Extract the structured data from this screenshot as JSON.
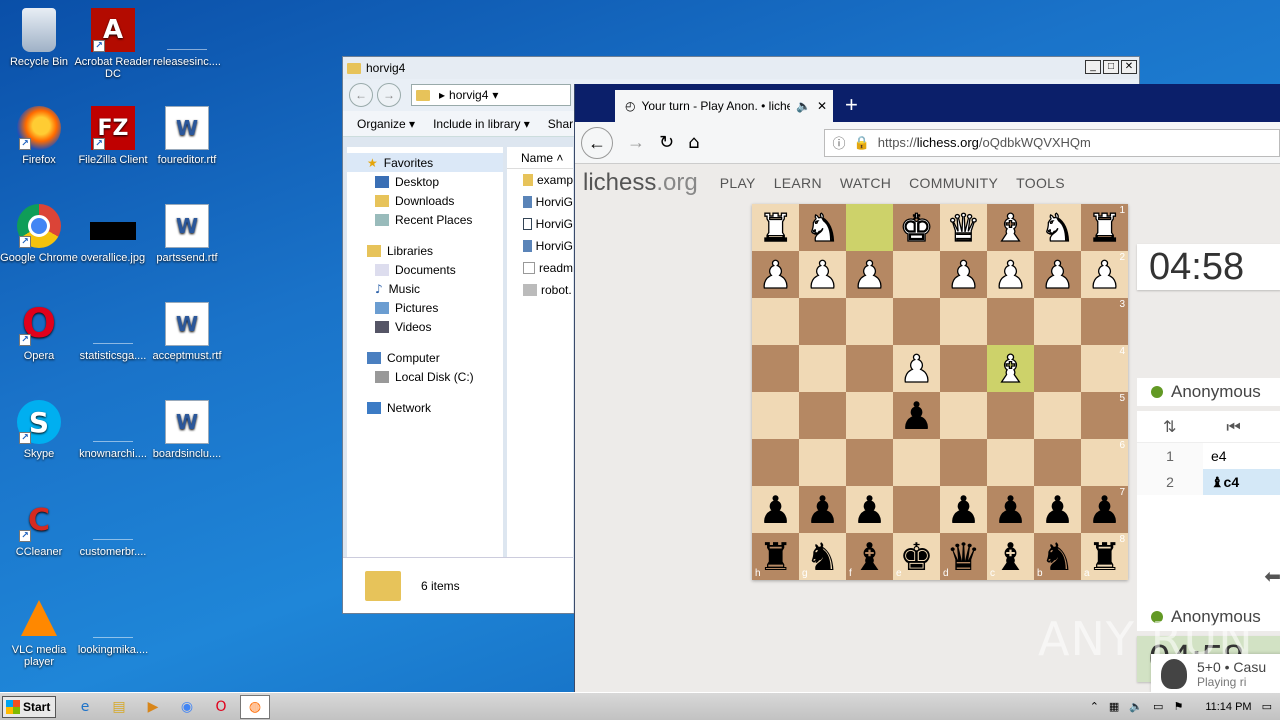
{
  "desktop": {
    "icons": [
      {
        "label": "Recycle Bin",
        "glyph": ""
      },
      {
        "label": "Acrobat Reader DC",
        "glyph": "A"
      },
      {
        "label": "releasesinc....",
        "glyph": ""
      },
      {
        "label": "Firefox",
        "glyph": ""
      },
      {
        "label": "FileZilla Client",
        "glyph": "FZ"
      },
      {
        "label": "foureditor.rtf",
        "glyph": "W"
      },
      {
        "label": "Google Chrome",
        "glyph": ""
      },
      {
        "label": "overallice.jpg",
        "glyph": ""
      },
      {
        "label": "partssend.rtf",
        "glyph": "W"
      },
      {
        "label": "Opera",
        "glyph": "O"
      },
      {
        "label": "statisticsga....",
        "glyph": ""
      },
      {
        "label": "acceptmust.rtf",
        "glyph": "W"
      },
      {
        "label": "Skype",
        "glyph": "S"
      },
      {
        "label": "knownarchi....",
        "glyph": ""
      },
      {
        "label": "boardsinclu....",
        "glyph": "W"
      },
      {
        "label": "CCleaner",
        "glyph": "C"
      },
      {
        "label": "customerbr....",
        "glyph": ""
      },
      {
        "label": "VLC media player",
        "glyph": ""
      },
      {
        "label": "lookingmika....",
        "glyph": ""
      }
    ]
  },
  "explorer": {
    "title": "horvig4",
    "address": "horvig4",
    "commands": {
      "organize": "Organize ▾",
      "include": "Include in library ▾",
      "share": "Shar"
    },
    "nav": {
      "favorites": "Favorites",
      "desktop": "Desktop",
      "downloads": "Downloads",
      "recent": "Recent Places",
      "libraries": "Libraries",
      "documents": "Documents",
      "music": "Music",
      "pictures": "Pictures",
      "videos": "Videos",
      "computer": "Computer",
      "localdisk": "Local Disk (C:)",
      "network": "Network"
    },
    "files_header": "Name",
    "files": [
      "examp",
      "HorviG",
      "HorviG",
      "HorviG",
      "readm",
      "robot."
    ],
    "status": "6 items"
  },
  "firefox": {
    "tab_title": "Your turn - Play Anon. • lichess",
    "url_host": "lichess.org",
    "url_prefix": "https://",
    "url_path": "/oQdbkWQVXHQm"
  },
  "lichess": {
    "logo": "lichess",
    "logo_tld": ".org",
    "nav": [
      "PLAY",
      "LEARN",
      "WATCH",
      "COMMUNITY",
      "TOOLS"
    ],
    "board": [
      [
        "wR",
        "wN",
        "",
        "wK",
        "wQ",
        "wB",
        "wN",
        "wR"
      ],
      [
        "wP",
        "wP",
        "wP",
        "",
        "wP",
        "wP",
        "wP",
        "wP"
      ],
      [
        "",
        "",
        "",
        "",
        "",
        "",
        "",
        ""
      ],
      [
        "",
        "",
        "",
        "wP",
        "",
        "wB",
        "",
        ""
      ],
      [
        "",
        "",
        "",
        "bP",
        "",
        "",
        "",
        ""
      ],
      [
        "",
        "",
        "",
        "",
        "",
        "",
        "",
        ""
      ],
      [
        "bP",
        "bP",
        "bP",
        "",
        "bP",
        "bP",
        "bP",
        "bP"
      ],
      [
        "bR",
        "bN",
        "bB",
        "bK",
        "bQ",
        "bB",
        "bN",
        "bR"
      ]
    ],
    "highlight": [
      [
        0,
        2
      ],
      [
        3,
        5
      ]
    ],
    "ranks": [
      "1",
      "2",
      "3",
      "4",
      "5",
      "6",
      "7",
      "8"
    ],
    "files": [
      "h",
      "g",
      "f",
      "e",
      "d",
      "c",
      "b",
      "a"
    ],
    "clock_top": "04:58",
    "clock_bottom": "04:58",
    "player_top": "Anonymous",
    "player_bottom": "Anonymous",
    "moves": [
      {
        "num": "1",
        "san": "e4"
      },
      {
        "num": "2",
        "san": "♝c4"
      }
    ],
    "game_card_title": "5+0 • Casu",
    "game_card_sub": "Playing ri"
  },
  "watermark": "ANY RUN",
  "taskbar": {
    "start": "Start",
    "time": "11:14 PM"
  }
}
